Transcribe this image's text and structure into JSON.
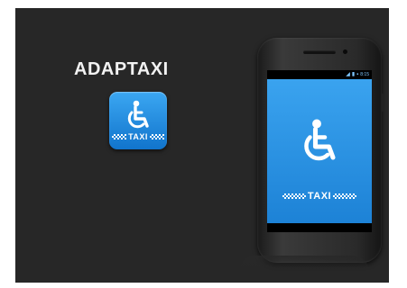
{
  "app": {
    "title": "ADAPTAXI",
    "icon_name": "wheelchair-icon",
    "taxi_label": "TAXI"
  },
  "phone": {
    "screen_taxi_label": "TAXI",
    "status_icons": [
      "wifi-icon",
      "signal-icon",
      "battery-icon"
    ],
    "status_time": "8:15"
  },
  "colors": {
    "banner_bg": "#272727",
    "accent_blue": "#2a90e6"
  }
}
